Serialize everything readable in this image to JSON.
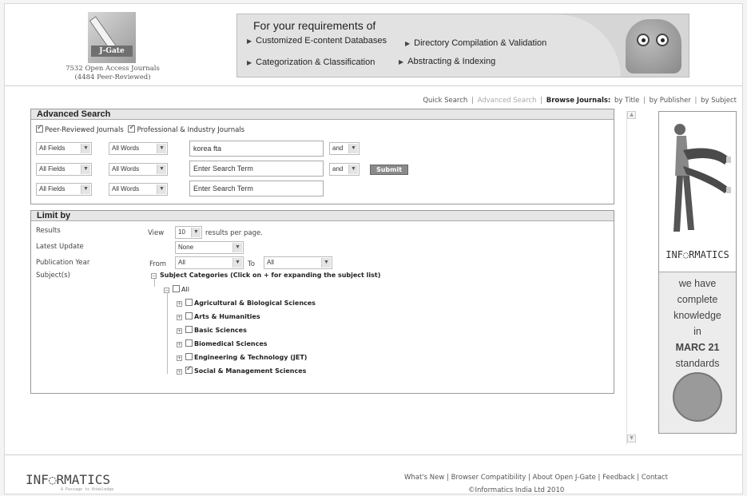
{
  "header": {
    "logo_text": "J-Gate",
    "journal_count_line1": "7532 Open Access Journals",
    "journal_count_line2": "(4484 Peer-Reviewed)"
  },
  "banner": {
    "title": "For your requirements of",
    "items": [
      "Customized E-content Databases",
      "Directory Compilation & Validation",
      "Categorization & Classification",
      "Abstracting & Indexing"
    ]
  },
  "nav": {
    "quick_search": "Quick Search",
    "advanced_search": "Advanced Search",
    "browse_label": "Browse Journals:",
    "by_title": "by Title",
    "by_publisher": "by Publisher",
    "by_subject": "by Subject"
  },
  "advanced_search": {
    "heading": "Advanced Search",
    "peer_reviewed_label": "Peer-Reviewed Journals",
    "professional_label": "Professional & Industry Journals",
    "rows": [
      {
        "field": "All Fields",
        "words": "All Words",
        "term": "korea fta",
        "op": "and"
      },
      {
        "field": "All Fields",
        "words": "All Words",
        "term": "Enter Search Term",
        "op": "and"
      },
      {
        "field": "All Fields",
        "words": "All Words",
        "term": "Enter Search Term",
        "op": ""
      }
    ],
    "submit_label": "Submit"
  },
  "limit_by": {
    "heading": "Limit by",
    "results_label": "Results",
    "view_label": "View",
    "per_page_value": "10",
    "per_page_suffix": "results per page.",
    "latest_update_label": "Latest Update",
    "latest_update_value": "None",
    "pub_year_label": "Publication Year",
    "from_label": "From",
    "from_value": "All",
    "to_label": "To",
    "to_value": "All",
    "subjects_label": "Subject(s)",
    "tree_root": "Subject Categories (Click on + for expanding the subject list)",
    "tree_all": "All",
    "categories": [
      {
        "label": "Agricultural & Biological Sciences",
        "checked": false
      },
      {
        "label": "Arts & Humanities",
        "checked": false
      },
      {
        "label": "Basic Sciences",
        "checked": false
      },
      {
        "label": "Biomedical Sciences",
        "checked": false
      },
      {
        "label": "Engineering & Technology (JET)",
        "checked": false
      },
      {
        "label": "Social & Management Sciences",
        "checked": true
      }
    ]
  },
  "ad": {
    "brand": "INF◌RMATICS",
    "lines": [
      "we have",
      "complete",
      "knowledge",
      "in"
    ],
    "bold_line": "MARC 21",
    "last_line": "standards"
  },
  "footer": {
    "logo": "INF◌RMATICS",
    "tagline": "A Passage to Knowledge",
    "links": [
      "What's New",
      "Browser Compatibility",
      "About Open J-Gate",
      "Feedback",
      "Contact"
    ],
    "copyright": "©Informatics India Ltd 2010"
  }
}
